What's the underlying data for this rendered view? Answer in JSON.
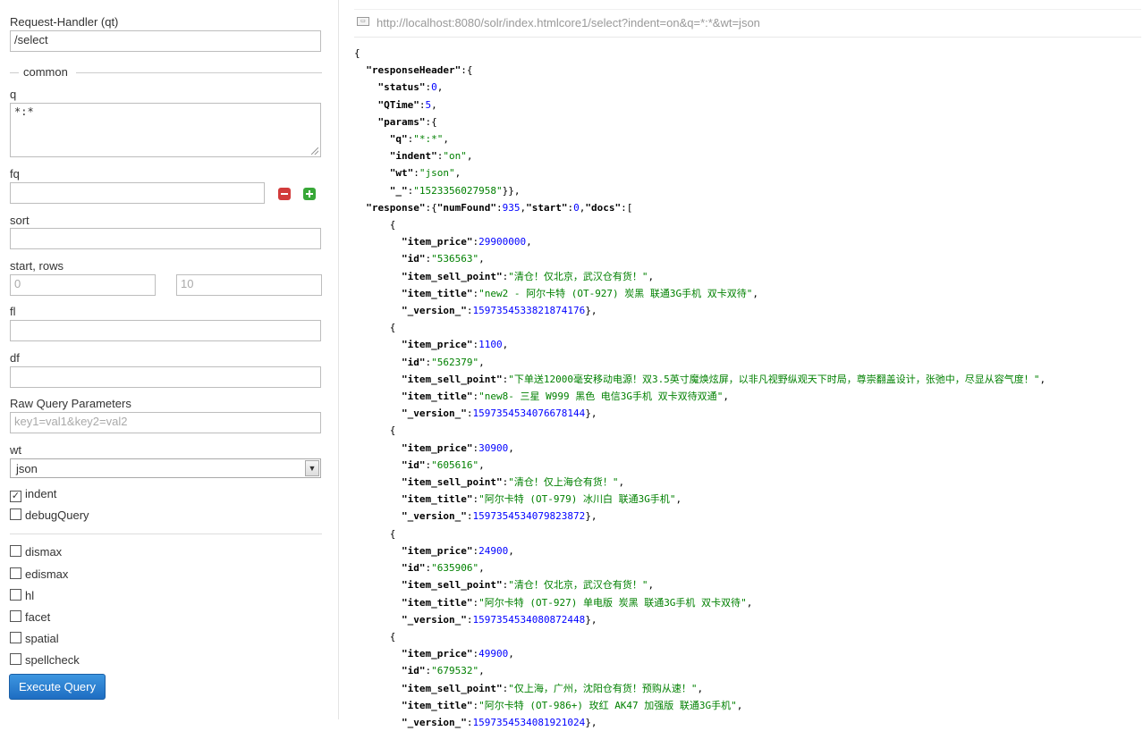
{
  "form": {
    "request_handler_label": "Request-Handler (qt)",
    "request_handler_value": "/select",
    "common_label": "common",
    "q_label": "q",
    "q_value": "*:*",
    "fq_label": "fq",
    "fq_value": "",
    "sort_label": "sort",
    "sort_value": "",
    "start_rows_label": "start, rows",
    "start_placeholder": "0",
    "rows_placeholder": "10",
    "fl_label": "fl",
    "fl_value": "",
    "df_label": "df",
    "df_value": "",
    "raw_label": "Raw Query Parameters",
    "raw_placeholder": "key1=val1&key2=val2",
    "wt_label": "wt",
    "wt_value": "json",
    "indent_label": "indent",
    "indent_checked": true,
    "debug_label": "debugQuery",
    "debug_checked": false,
    "options": [
      "dismax",
      "edismax",
      "hl",
      "facet",
      "spatial",
      "spellcheck"
    ],
    "execute_label": "Execute Query"
  },
  "result": {
    "url": "http://localhost:8080/solr/index.htmlcore1/select?indent=on&q=*:*&wt=json",
    "header": {
      "status": "0",
      "qtime": "5",
      "params": [
        {
          "k": "q",
          "v": "*:*"
        },
        {
          "k": "indent",
          "v": "on"
        },
        {
          "k": "wt",
          "v": "json"
        },
        {
          "k": "_",
          "v": "1523356027958"
        }
      ]
    },
    "numFound": "935",
    "start": "0",
    "docs": [
      {
        "item_price": "29900000",
        "id": "536563",
        "item_sell_point": "清仓！仅北京，武汉仓有货！",
        "item_title": "new2 - 阿尔卡特 (OT-927) 炭黑 联通3G手机 双卡双待",
        "_version_": "1597354533821874176"
      },
      {
        "item_price": "1100",
        "id": "562379",
        "item_sell_point": "下单送12000毫安移动电源！双3.5英寸魔焕炫屏，以非凡视野纵观天下时局，尊崇翻盖设计，张弛中，尽显从容气度！",
        "item_title": "new8- 三星 W999 黑色 电信3G手机 双卡双待双通",
        "_version_": "1597354534076678144"
      },
      {
        "item_price": "30900",
        "id": "605616",
        "item_sell_point": "清仓！仅上海仓有货！",
        "item_title": "阿尔卡特 (OT-979) 冰川白 联通3G手机",
        "_version_": "1597354534079823872"
      },
      {
        "item_price": "24900",
        "id": "635906",
        "item_sell_point": "清仓！仅北京，武汉仓有货！",
        "item_title": "阿尔卡特 (OT-927) 单电版 炭黑 联通3G手机 双卡双待",
        "_version_": "1597354534080872448"
      },
      {
        "item_price": "49900",
        "id": "679532",
        "item_sell_point": "仅上海，广州，沈阳仓有货！预购从速！",
        "item_title": "阿尔卡特 (OT-986+) 玫红 AK47 加强版 联通3G手机",
        "_version_": "1597354534081921024"
      }
    ]
  }
}
